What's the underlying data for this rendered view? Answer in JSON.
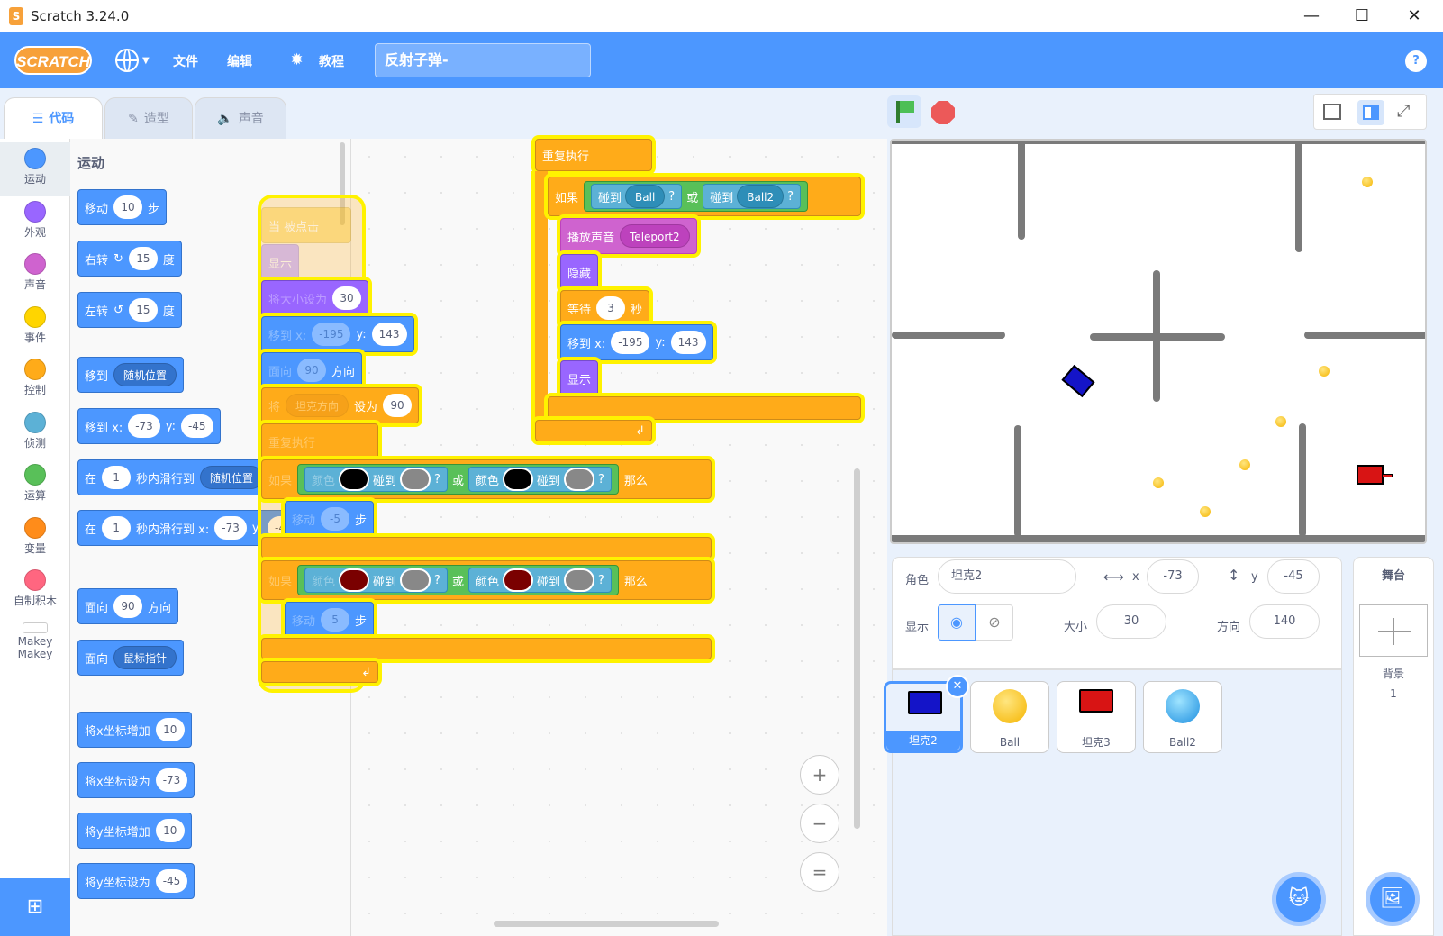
{
  "window": {
    "title": "Scratch 3.24.0",
    "app_icon": "scratch-cat-icon",
    "min": "—",
    "max": "☐",
    "close": "✕"
  },
  "menu": {
    "logo": "SCRATCH",
    "file": "文件",
    "edit": "编辑",
    "tutorials": "教程",
    "project_title": "反射子弹-",
    "help": "?",
    "globe_icon": "globe-icon"
  },
  "tabs": {
    "code": "代码",
    "costumes": "造型",
    "sounds": "声音"
  },
  "categories": [
    {
      "label": "运动",
      "color": "#4c97ff"
    },
    {
      "label": "外观",
      "color": "#9966ff"
    },
    {
      "label": "声音",
      "color": "#cf63cf"
    },
    {
      "label": "事件",
      "color": "#ffd500"
    },
    {
      "label": "控制",
      "color": "#ffab19"
    },
    {
      "label": "侦测",
      "color": "#5cb1d6"
    },
    {
      "label": "运算",
      "color": "#59c059"
    },
    {
      "label": "变量",
      "color": "#ff8c1a"
    },
    {
      "label": "自制积木",
      "color": "#ff6680"
    },
    {
      "label": "Makey Makey",
      "color": "#ffffff"
    }
  ],
  "palette": {
    "title": "运动",
    "move": {
      "a": "移动",
      "v": "10",
      "b": "步"
    },
    "turn_right": {
      "a": "右转",
      "v": "15",
      "b": "度"
    },
    "turn_left": {
      "a": "左转",
      "v": "15",
      "b": "度"
    },
    "goto": {
      "a": "移到",
      "d": "随机位置"
    },
    "gotoxy": {
      "a": "移到 x:",
      "x": "-73",
      "y_label": "y:",
      "y": "-45"
    },
    "glide1": {
      "a": "在",
      "v": "1",
      "b": "秒内滑行到",
      "d": "随机位置"
    },
    "glide2": {
      "a": "在",
      "v": "1",
      "b": "秒内滑行到 x:",
      "x": "-73",
      "y_label": "y:",
      "y": "-45"
    },
    "point": {
      "a": "面向",
      "v": "90",
      "b": "方向"
    },
    "pointto": {
      "a": "面向",
      "d": "鼠标指针"
    },
    "changex": {
      "a": "将x坐标增加",
      "v": "10"
    },
    "setx": {
      "a": "将x坐标设为",
      "v": "-73"
    },
    "changey": {
      "a": "将y坐标增加",
      "v": "10"
    },
    "sety": {
      "a": "将y坐标设为",
      "v": "-45"
    }
  },
  "script_left": {
    "hat": "当   被点击",
    "show": "显示",
    "setsize": {
      "a": "将大小设为",
      "v": "30"
    },
    "gotoxy": {
      "a": "移到 x:",
      "x": "-195",
      "y_label": "y:",
      "y": "143"
    },
    "point": {
      "a": "面向",
      "v": "90",
      "b": "方向"
    },
    "setvar": {
      "a": "将",
      "d": "坦克方向",
      "b": "设为",
      "v": "90"
    },
    "forever": "重复执行",
    "if1": {
      "a": "如果",
      "c1": "颜色",
      "t1": "碰到",
      "q": "?",
      "or": "或",
      "c2": "颜色",
      "t2": "碰到",
      "then": "那么"
    },
    "move1": {
      "a": "移动",
      "v": "-5",
      "b": "步"
    },
    "if2": {
      "a": "如果",
      "c1": "颜色",
      "t1": "碰到",
      "q": "?",
      "or": "或",
      "c2": "颜色",
      "t2": "碰到",
      "then": "那么"
    },
    "move2": {
      "a": "移动",
      "v": "5",
      "b": "步"
    }
  },
  "script_right": {
    "forever": "重复执行",
    "if": {
      "a": "如果",
      "t1": "碰到",
      "d1": "Ball",
      "q": "?",
      "or": "或",
      "t2": "碰到",
      "d2": "Ball2"
    },
    "playsound": {
      "a": "播放声音",
      "d": "Teleport2"
    },
    "hide": "隐藏",
    "wait": {
      "a": "等待",
      "v": "3",
      "b": "秒"
    },
    "gotoxy": {
      "a": "移到 x:",
      "x": "-195",
      "y_label": "y:",
      "y": "143"
    },
    "show": "显示"
  },
  "sprite_info": {
    "label_sprite": "角色",
    "name": "坦克2",
    "x_label": "x",
    "x": "-73",
    "y_label": "y",
    "y": "-45",
    "show_label": "显示",
    "size_label": "大小",
    "size": "30",
    "dir_label": "方向",
    "direction": "140"
  },
  "sprites": [
    {
      "name": "坦克2",
      "selected": true
    },
    {
      "name": "Ball",
      "selected": false
    },
    {
      "name": "坦克3",
      "selected": false
    },
    {
      "name": "Ball2",
      "selected": false
    }
  ],
  "stage_panel": {
    "title": "舞台",
    "backdrops_label": "背景",
    "backdrops_count": "1"
  },
  "zoom": {
    "in": "+",
    "out": "−",
    "reset": "="
  }
}
